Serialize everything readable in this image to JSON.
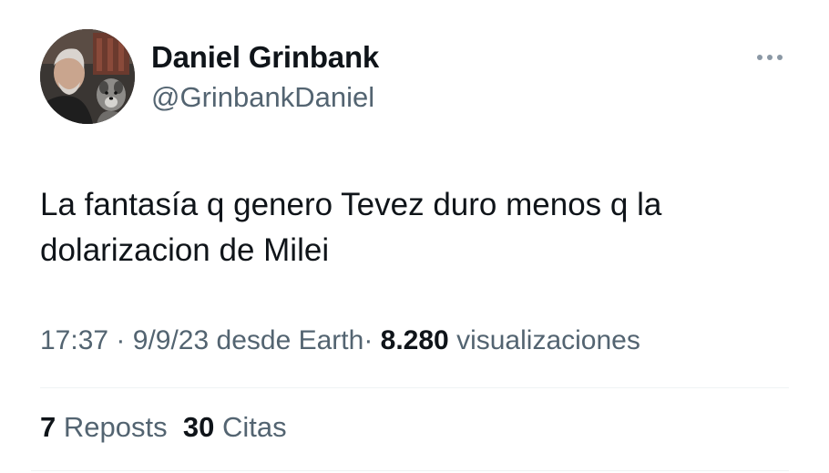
{
  "author": {
    "display_name": "Daniel Grinbank",
    "handle": "@GrinbankDaniel",
    "avatar_icon": "profile-photo-with-dog"
  },
  "more_icon": "more-dots-icon",
  "tweet": {
    "text_line1": "La fantasía q genero Tevez duro menos q la",
    "text_line2": "dolarizacion de Milei"
  },
  "meta": {
    "time": "17:37",
    "date": "9/9/23",
    "source": "desde Earth",
    "views_count": "8.280",
    "views_label": "visualizaciones",
    "separator": "·"
  },
  "stats": {
    "reposts_count": "7",
    "reposts_label": "Reposts",
    "quotes_count": "30",
    "quotes_label": "Citas"
  },
  "colors": {
    "text": "#0f1419",
    "secondary": "#536471",
    "divider": "#eff3f4"
  }
}
